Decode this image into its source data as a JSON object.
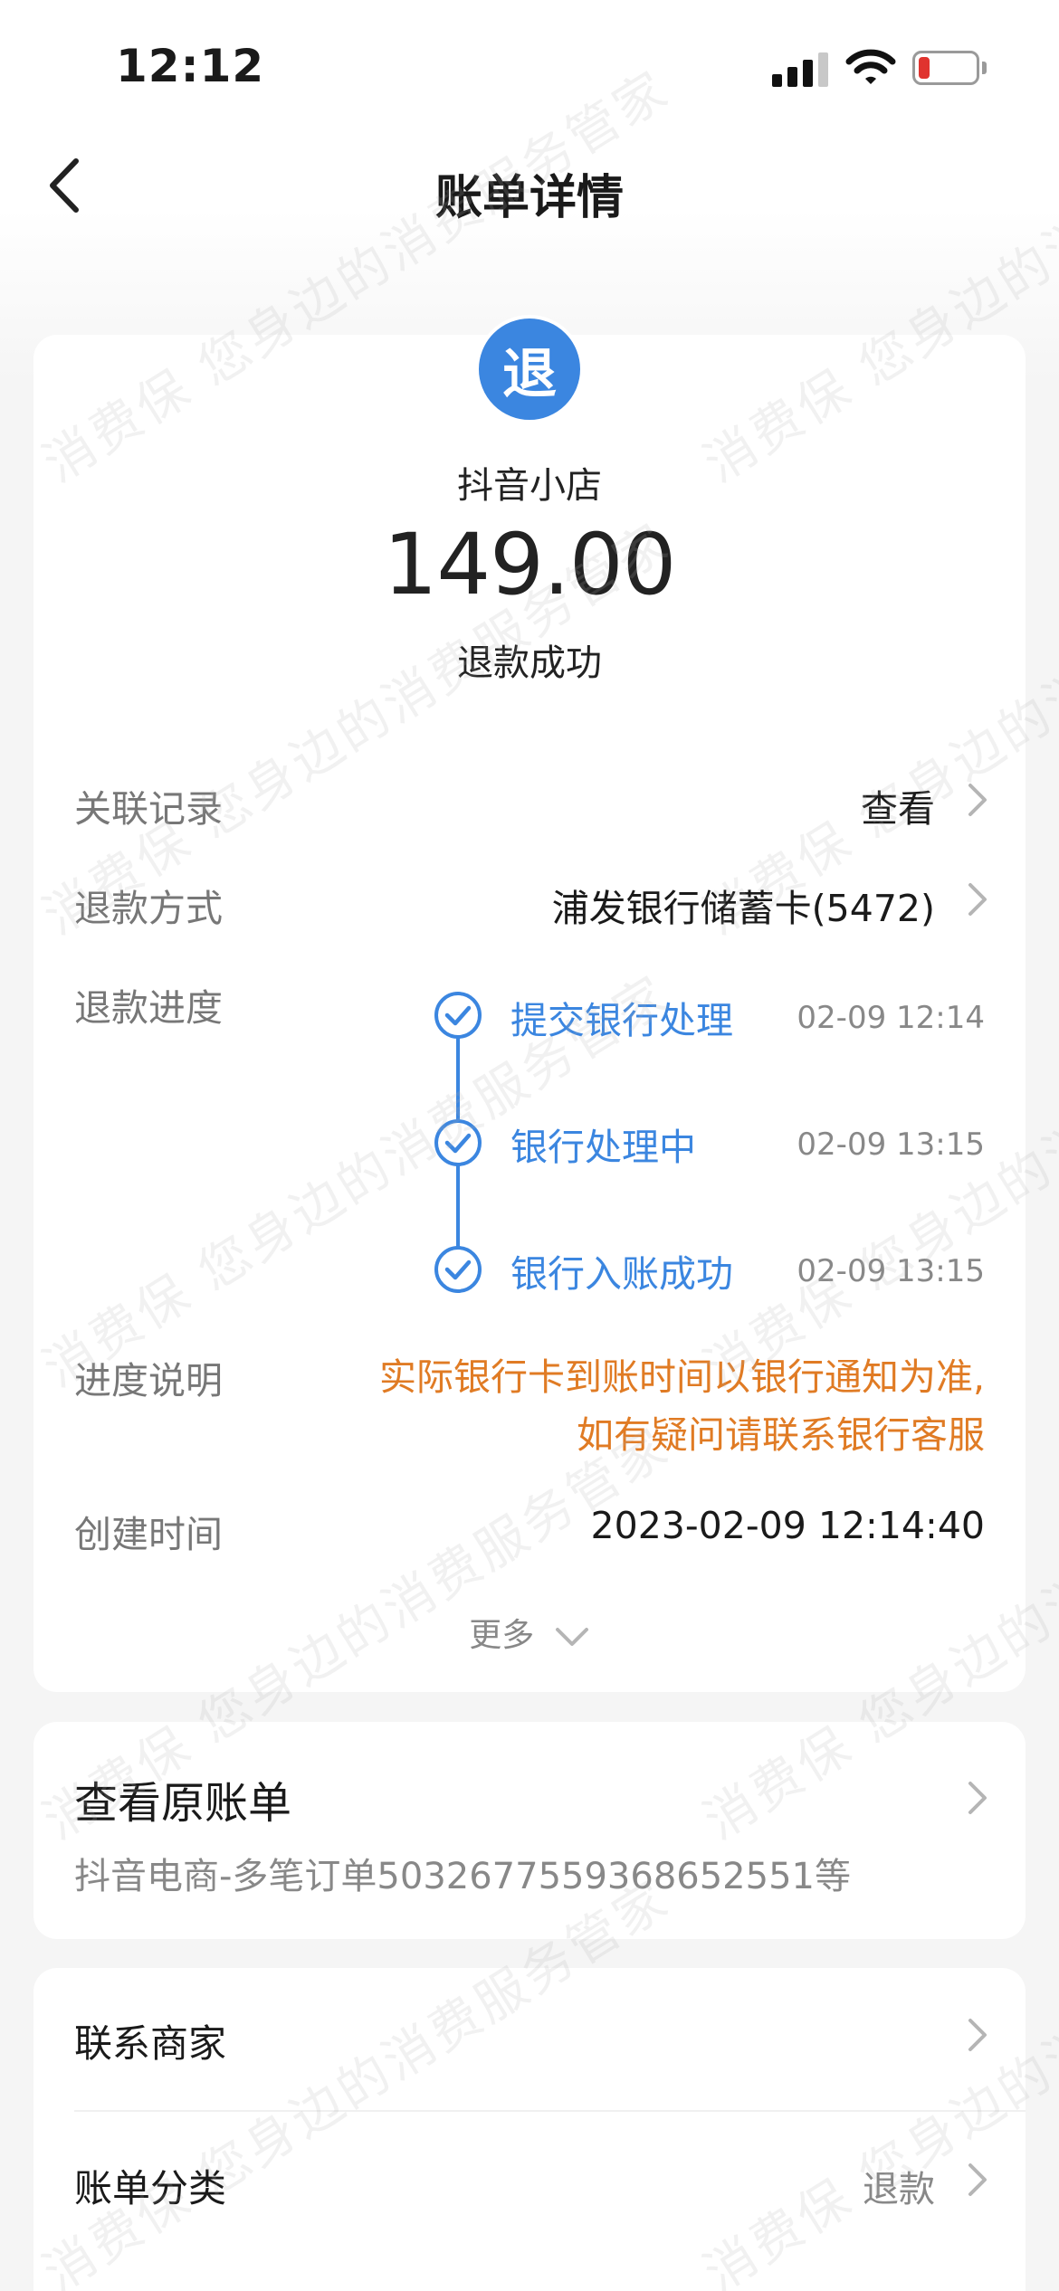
{
  "status_bar": {
    "time": "12:12"
  },
  "nav": {
    "title": "账单详情"
  },
  "summary": {
    "icon_char": "退",
    "merchant": "抖音小店",
    "amount": "149.00",
    "status": "退款成功"
  },
  "details": {
    "related": {
      "label": "关联记录",
      "value": "查看"
    },
    "refund_method": {
      "label": "退款方式",
      "value": "浦发银行储蓄卡(5472)"
    },
    "progress": {
      "label": "退款进度",
      "steps": [
        {
          "label": "提交银行处理",
          "time": "02-09 12:14"
        },
        {
          "label": "银行处理中",
          "time": "02-09 13:15"
        },
        {
          "label": "银行入账成功",
          "time": "02-09 13:15"
        }
      ]
    },
    "note": {
      "label": "进度说明",
      "line1": "实际银行卡到账时间以银行通知为准,",
      "line2": "如有疑问请联系银行客服"
    },
    "created": {
      "label": "创建时间",
      "value": "2023-02-09 12:14:40"
    },
    "more": "更多"
  },
  "original_bill": {
    "title": "查看原账单",
    "subtitle": "抖音电商-多笔订单5032677559368652551等"
  },
  "links": {
    "contact": {
      "label": "联系商家"
    },
    "category": {
      "label": "账单分类",
      "value": "退款"
    }
  },
  "watermark": "消费保 您身边的消费服务管家",
  "colors": {
    "accent": "#3b86e0",
    "note": "#e07b24"
  }
}
